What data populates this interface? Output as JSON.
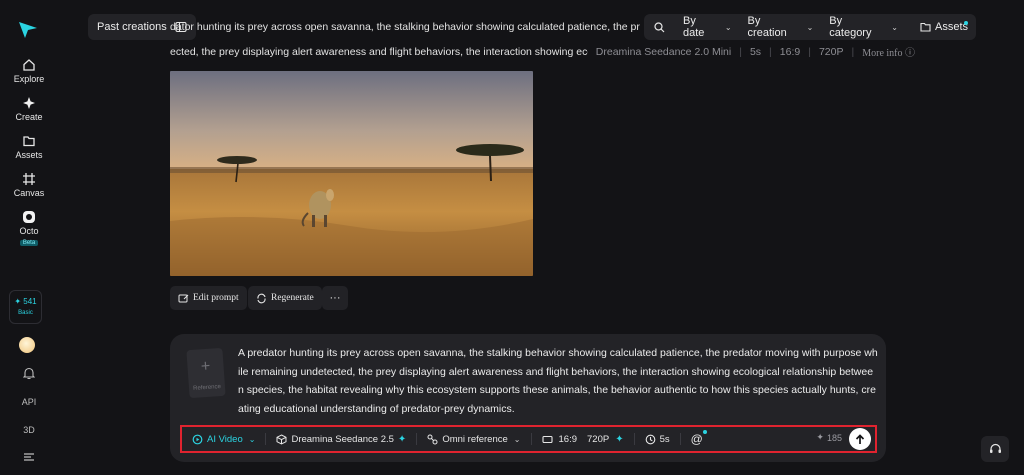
{
  "nav": {
    "items": [
      {
        "label": "Explore",
        "icon": "home-icon"
      },
      {
        "label": "Create",
        "icon": "sparkle-icon"
      },
      {
        "label": "Assets",
        "icon": "folder-icon"
      },
      {
        "label": "Canvas",
        "icon": "canvas-icon"
      },
      {
        "label": "Octo",
        "icon": "octo-icon"
      }
    ],
    "beta_label": "Beta",
    "credits": "541",
    "plan": "Basic",
    "api_label": "API",
    "threed_label": "3D"
  },
  "topbar": {
    "past_creations": "Past creations",
    "filters": [
      "By date",
      "By creation",
      "By category"
    ],
    "assets": "Assets"
  },
  "history": {
    "prompt_line1": "dator hunting its prey across open savanna, the stalking behavior showing calculated patience, the predator moving with purpose while remaining undet",
    "prompt_line2": "ected, the prey displaying alert awareness and flight behaviors, the interaction showing ecological relationship betwe",
    "model": "Dreamina Seedance 2.0 Mini",
    "duration": "5s",
    "ratio": "16:9",
    "resolution": "720P",
    "more_info": "More info",
    "actions": {
      "edit": "Edit prompt",
      "regenerate": "Regenerate"
    }
  },
  "composer": {
    "reference_label": "Reference",
    "prompt": "A predator hunting its prey across open savanna, the stalking behavior showing calculated patience, the predator moving with purpose while remaining undetected, the prey displaying alert awareness and flight behaviors, the interaction showing ecological relationship between species, the habitat revealing why this ecosystem supports these animals, the behavior authentic to how this species actually hunts, creating educational understanding of predator-prey dynamics.",
    "mode": "AI Video",
    "model": "Dreamina Seedance 2.5",
    "reference_mode": "Omni reference",
    "ratio": "16:9",
    "resolution": "720P",
    "duration": "5s",
    "cost": "185"
  },
  "colors": {
    "accent": "#2bd4e2",
    "highlight_border": "#e0232f",
    "background": "#131316"
  }
}
